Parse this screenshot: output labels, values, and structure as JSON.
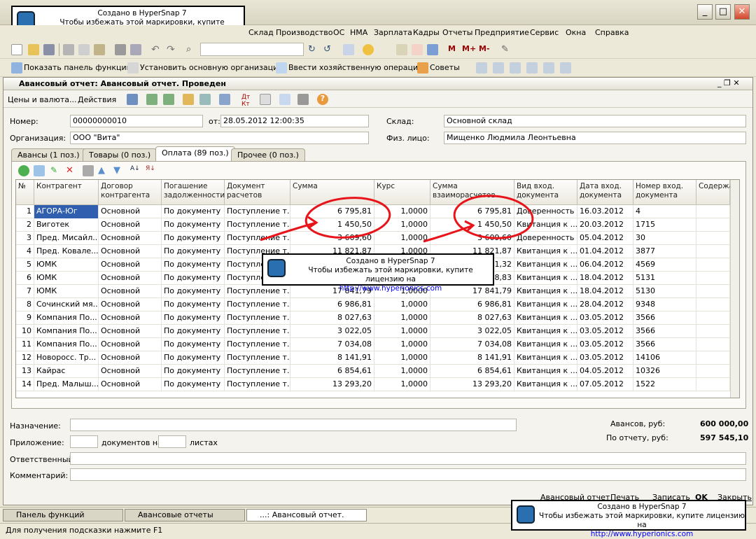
{
  "watermark": {
    "line1": "Создано в HyperSnap 7",
    "line2": "Чтобы избежать этой маркировки, купите лицензию на",
    "url": "http://www.hyperionics.com"
  },
  "menu": [
    "Склад",
    "Производство",
    "ОС",
    "НМА",
    "Зарплата",
    "Кадры",
    "Отчеты",
    "Предприятие",
    "Сервис",
    "Окна",
    "Справка"
  ],
  "toolbar2": {
    "show_panel": "Показать панель функций",
    "set_org": "Установить основную организацию",
    "enter_op": "Ввести хозяйственную операцию",
    "tips": "Советы"
  },
  "document": {
    "title": "Авансовый отчет: Авансовый отчет. Проведен",
    "tb_prices": "Цены и валюта...",
    "tb_actions": "Действия",
    "number_label": "Номер:",
    "number": "00000000010",
    "date_label": "от:",
    "date": "28.05.2012 12:00:35",
    "warehouse_label": "Склад:",
    "warehouse": "Основной склад",
    "org_label": "Организация:",
    "org": "ООО \"Вита\"",
    "person_label": "Физ. лицо:",
    "person": "Мищенко Людмила Леонтьевна"
  },
  "tabs": [
    "Авансы (1 поз.)",
    "Товары (0 поз.)",
    "Оплата (89 поз.)",
    "Прочее (0 поз.)"
  ],
  "table": {
    "headers": [
      "№",
      "Контрагент",
      "Договор контрагента",
      "Погашение задолженности",
      "Документ расчетов",
      "Сумма",
      "Курс",
      "Сумма взаиморасчетов",
      "Вид вход. документа",
      "Дата вход. документа",
      "Номер вход. документа",
      "Содержа"
    ],
    "rows": [
      [
        "1",
        "АГОРА-Юг",
        "Основной",
        "По документу",
        "Поступление т...",
        "6 795,81",
        "1,0000",
        "6 795,81",
        "Доверенность",
        "16.03.2012",
        "4"
      ],
      [
        "2",
        "Виготек",
        "Основной",
        "По документу",
        "Поступление т...",
        "1 450,50",
        "1,0000",
        "1 450,50",
        "Квитанция к ...",
        "20.03.2012",
        "1715"
      ],
      [
        "3",
        "Пред. Мисайл...",
        "Основной",
        "По документу",
        "Поступление т...",
        "3 609,60",
        "1,0000",
        "3 609,60",
        "Доверенность",
        "05.04.2012",
        "30"
      ],
      [
        "4",
        "Пред. Ковале...",
        "Основной",
        "По документу",
        "Поступление т...",
        "11 821,87",
        "1,0000",
        "11 821,87",
        "Квитанция к ...",
        "01.04.2012",
        "3877"
      ],
      [
        "5",
        "ЮМК",
        "Основной",
        "По документу",
        "Поступление т...",
        "",
        "",
        "11,32",
        "Квитанция к ...",
        "06.04.2012",
        "4569"
      ],
      [
        "6",
        "ЮМК",
        "Основной",
        "По документу",
        "Поступление т...",
        "",
        "",
        "8,83",
        "Квитанция к ...",
        "18.04.2012",
        "5131"
      ],
      [
        "7",
        "ЮМК",
        "Основной",
        "По документу",
        "Поступление т...",
        "17 841,79",
        "1,0000",
        "17 841,79",
        "Квитанция к ...",
        "18.04.2012",
        "5130"
      ],
      [
        "8",
        "Сочинский мя...",
        "Основной",
        "По документу",
        "Поступление т...",
        "6 986,81",
        "1,0000",
        "6 986,81",
        "Квитанция к ...",
        "28.04.2012",
        "9348"
      ],
      [
        "9",
        "Компания По...",
        "Основной",
        "По документу",
        "Поступление т...",
        "8 027,63",
        "1,0000",
        "8 027,63",
        "Квитанция к ...",
        "03.05.2012",
        "3566"
      ],
      [
        "10",
        "Компания По...",
        "Основной",
        "По документу",
        "Поступление т...",
        "3 022,05",
        "1,0000",
        "3 022,05",
        "Квитанция к ...",
        "03.05.2012",
        "3566"
      ],
      [
        "11",
        "Компания По...",
        "Основной",
        "По документу",
        "Поступление т...",
        "7 034,08",
        "1,0000",
        "7 034,08",
        "Квитанция к ...",
        "03.05.2012",
        "3566"
      ],
      [
        "12",
        "Новоросс. Тр...",
        "Основной",
        "По документу",
        "Поступление т...",
        "8 141,91",
        "1,0000",
        "8 141,91",
        "Квитанция к ...",
        "03.05.2012",
        "14106"
      ],
      [
        "13",
        "Кайрас",
        "Основной",
        "По документу",
        "Поступление т...",
        "6 854,61",
        "1,0000",
        "6 854,61",
        "Квитанция к ...",
        "04.05.2012",
        "10326"
      ],
      [
        "14",
        "Пред. Малыш...",
        "Основной",
        "По документу",
        "Поступление т...",
        "13 293,20",
        "1,0000",
        "13 293,20",
        "Квитанция к ...",
        "07.05.2012",
        "1522"
      ]
    ]
  },
  "footer": {
    "purpose_label": "Назначение:",
    "attach_label": "Приложение:",
    "docs_on": "документов на",
    "sheets": "листах",
    "resp_label": "Ответственный:",
    "comment_label": "Комментарий:",
    "advance_label": "Авансов, руб:",
    "advance": "600 000,00",
    "report_label": "По отчету, руб:",
    "report": "597 545,10",
    "btn_report": "Авансовый отчет",
    "btn_print": "Печать",
    "btn_save": "Записать",
    "btn_ok": "OK",
    "btn_close": "Закрыть"
  },
  "tasks": [
    "Панель функций",
    "Авансовые отчеты",
    "...: Авансовый отчет. Прове..."
  ],
  "status": "Для получения подсказки нажмите F1"
}
